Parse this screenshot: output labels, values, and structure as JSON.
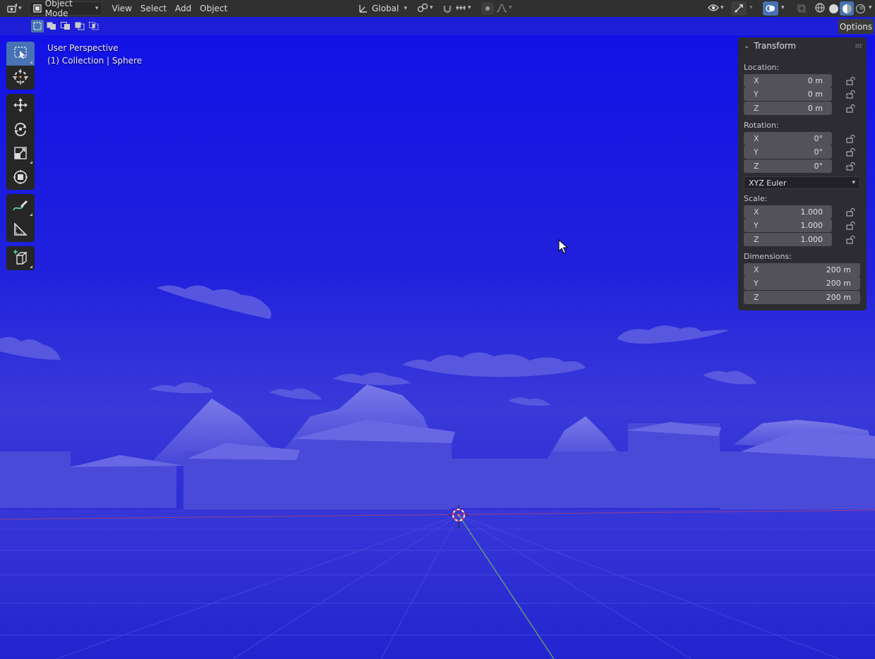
{
  "header": {
    "editor_type_icon": "editor-type-icon",
    "mode": "Object Mode",
    "menus": [
      "View",
      "Select",
      "Add",
      "Object"
    ],
    "orientation": "Global",
    "options_label": "Options"
  },
  "viewport": {
    "perspective_label": "User Perspective",
    "collection_label": "(1) Collection | Sphere"
  },
  "tools": [
    "select-box",
    "cursor",
    "move",
    "rotate",
    "scale",
    "transform",
    "annotate",
    "measure",
    "add-cube"
  ],
  "transform_panel": {
    "title": "Transform",
    "location_label": "Location:",
    "location": [
      {
        "axis": "X",
        "value": "0 m"
      },
      {
        "axis": "Y",
        "value": "0 m"
      },
      {
        "axis": "Z",
        "value": "0 m"
      }
    ],
    "rotation_label": "Rotation:",
    "rotation": [
      {
        "axis": "X",
        "value": "0°"
      },
      {
        "axis": "Y",
        "value": "0°"
      },
      {
        "axis": "Z",
        "value": "0°"
      }
    ],
    "rotation_mode": "XYZ Euler",
    "scale_label": "Scale:",
    "scale": [
      {
        "axis": "X",
        "value": "1.000"
      },
      {
        "axis": "Y",
        "value": "1.000"
      },
      {
        "axis": "Z",
        "value": "1.000"
      }
    ],
    "dimensions_label": "Dimensions:",
    "dimensions": [
      {
        "axis": "X",
        "value": "200 m"
      },
      {
        "axis": "Y",
        "value": "200 m"
      },
      {
        "axis": "Z",
        "value": "200 m"
      }
    ]
  },
  "colors": {
    "header_bg": "#303030",
    "accent": "#4772b3",
    "viewport_blue": "#2222dd",
    "panel_bg": "#2d2d2d"
  }
}
